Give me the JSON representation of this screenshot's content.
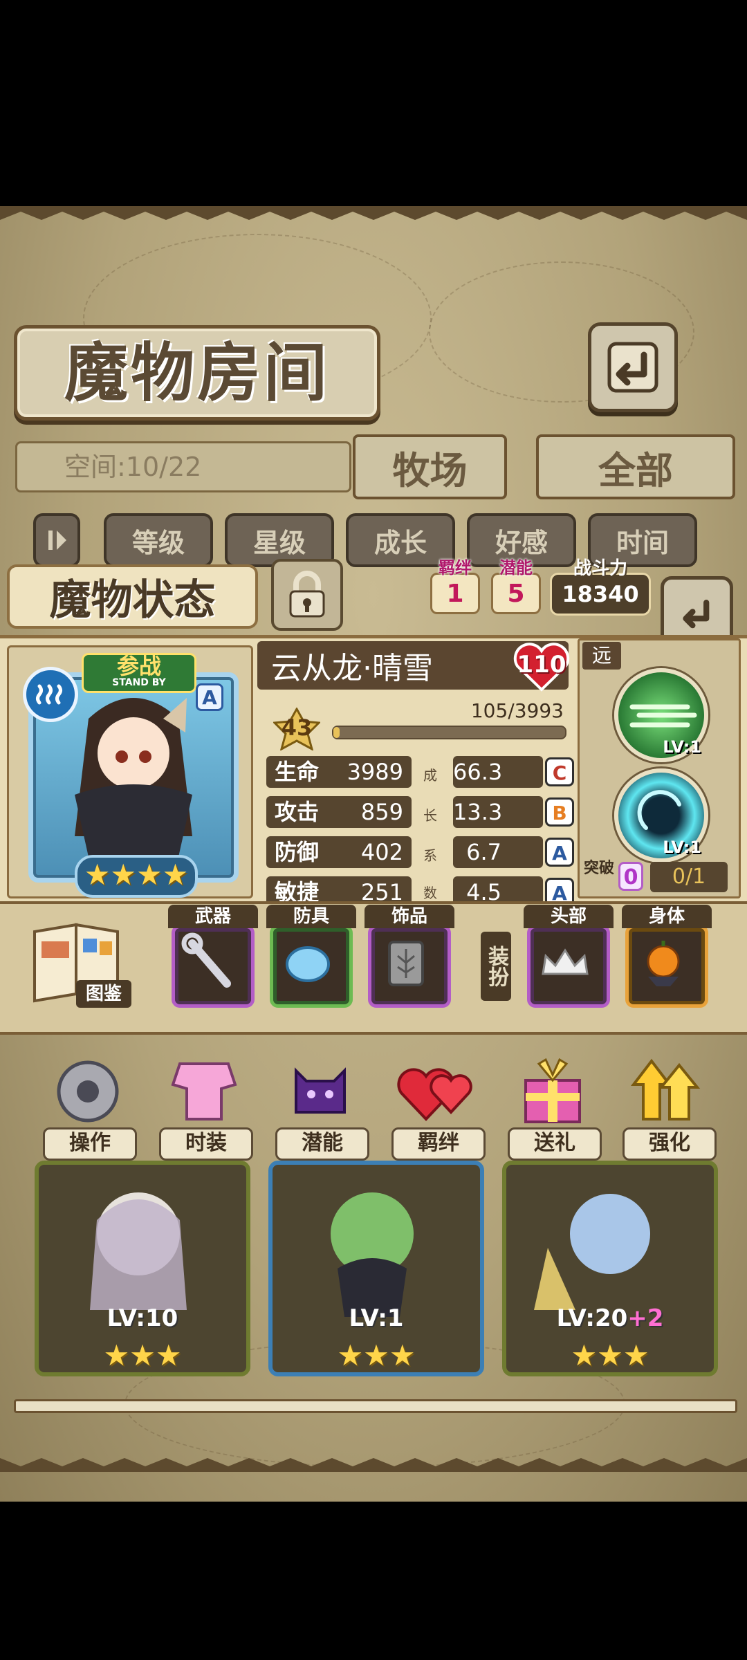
{
  "header": {
    "title": "魔物房间"
  },
  "storage": {
    "space_label": "空间:10/22"
  },
  "tabs": [
    {
      "label": "牧场"
    },
    {
      "label": "全部"
    }
  ],
  "filters": [
    "等级",
    "星级",
    "成长",
    "好感",
    "时间"
  ],
  "status": {
    "title": "魔物状态",
    "bond_label": "羁绊",
    "bond_value": "1",
    "potential_label": "潜能",
    "potential_value": "5",
    "power_label": "战斗力",
    "power_value": "18340"
  },
  "monster": {
    "name": "云从龙·晴雪",
    "heart_value": "110",
    "level": "43",
    "exp_text": "105/3993",
    "exp_progress": 0.026,
    "standby_label": "参战",
    "standby_sub": "STAND BY",
    "class_badge": "A",
    "stars": 4,
    "growth_label": [
      "成",
      "长",
      "系",
      "数"
    ],
    "stats": [
      {
        "name": "生命",
        "value": "3989",
        "growth": "66.3",
        "grade": "C"
      },
      {
        "name": "攻击",
        "value": "859",
        "growth": "13.3",
        "grade": "B"
      },
      {
        "name": "防御",
        "value": "402",
        "growth": "6.7",
        "grade": "A"
      },
      {
        "name": "敏捷",
        "value": "251",
        "growth": "4.5",
        "grade": "A"
      }
    ],
    "range_label": "远",
    "skills": [
      {
        "level": "LV:1"
      },
      {
        "level": "LV:1"
      }
    ],
    "breakthrough_label": "突破",
    "breakthrough_count": "0",
    "breakthrough_progress": "0/1"
  },
  "equipment": {
    "codex_label": "图鉴",
    "dress_label": "装扮",
    "slots": [
      {
        "label": "武器",
        "icon": "wrench-icon"
      },
      {
        "label": "防具",
        "icon": "shield-icon"
      },
      {
        "label": "饰品",
        "icon": "tablet-icon"
      },
      {
        "label": "头部",
        "icon": "tiara-icon"
      },
      {
        "label": "身体",
        "icon": "pumpkin-icon"
      }
    ]
  },
  "actions": [
    {
      "label": "操作",
      "icon": "gear-icon"
    },
    {
      "label": "时装",
      "icon": "outfit-icon"
    },
    {
      "label": "潜能",
      "icon": "demon-icon"
    },
    {
      "label": "羁绊",
      "icon": "hearts-icon"
    },
    {
      "label": "送礼",
      "icon": "gift-icon"
    },
    {
      "label": "强化",
      "icon": "arrows-up-icon"
    }
  ],
  "cards": [
    {
      "level": "LV:10",
      "bonus": "",
      "stars": 3
    },
    {
      "level": "LV:1",
      "bonus": "",
      "stars": 3
    },
    {
      "level": "LV:20",
      "bonus": "+2",
      "stars": 3
    }
  ],
  "colors": {
    "accent_gold": "#e8c25a",
    "brown_dark": "#56452f",
    "grade_c": "#c0392b",
    "grade_b": "#e67e22",
    "grade_a": "#2c5aa0"
  }
}
